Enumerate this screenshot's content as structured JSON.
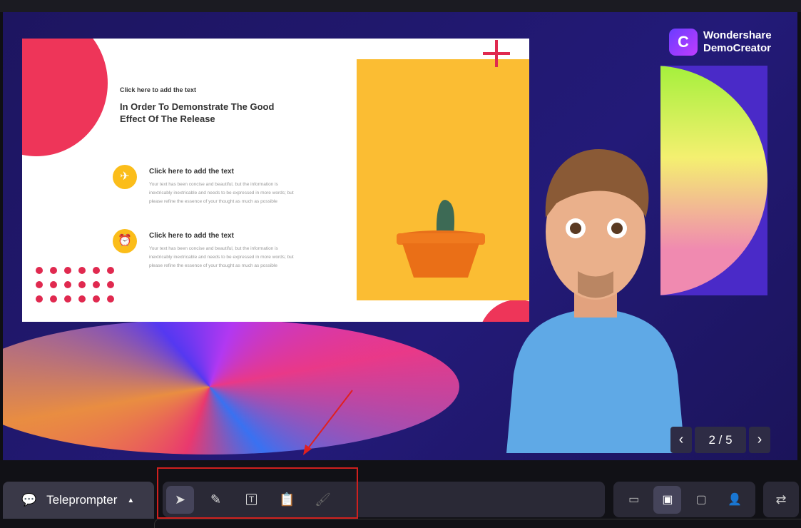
{
  "slide": {
    "small_label": "Click here to add the text",
    "title": "In Order To Demonstrate The Good Effect Of The Release",
    "items": [
      {
        "heading": "Click here to add the text",
        "body": "Your text has been concise and beautiful, but the information is inextricably inextricable and needs to be expressed in more words; but please refine the essence of your thought as much as possible",
        "icon": "airplane-icon"
      },
      {
        "heading": "Click here to add the text",
        "body": "Your text has been concise and beautiful, but the information is inextricably inextricable and needs to be expressed in more words; but please refine the essence of your thought as much as possible",
        "icon": "alarm-clock-icon"
      }
    ]
  },
  "logo": {
    "line1": "Wondershare",
    "line2": "DemoCreator"
  },
  "pager": {
    "current": "2 / 5"
  },
  "toolbar": {
    "teleprompter_label": "Teleprompter"
  },
  "colors": {
    "accent": "#ee3559",
    "yellow": "#fbbd33",
    "stage": "#1d1560",
    "annotation": "#d0201e"
  }
}
